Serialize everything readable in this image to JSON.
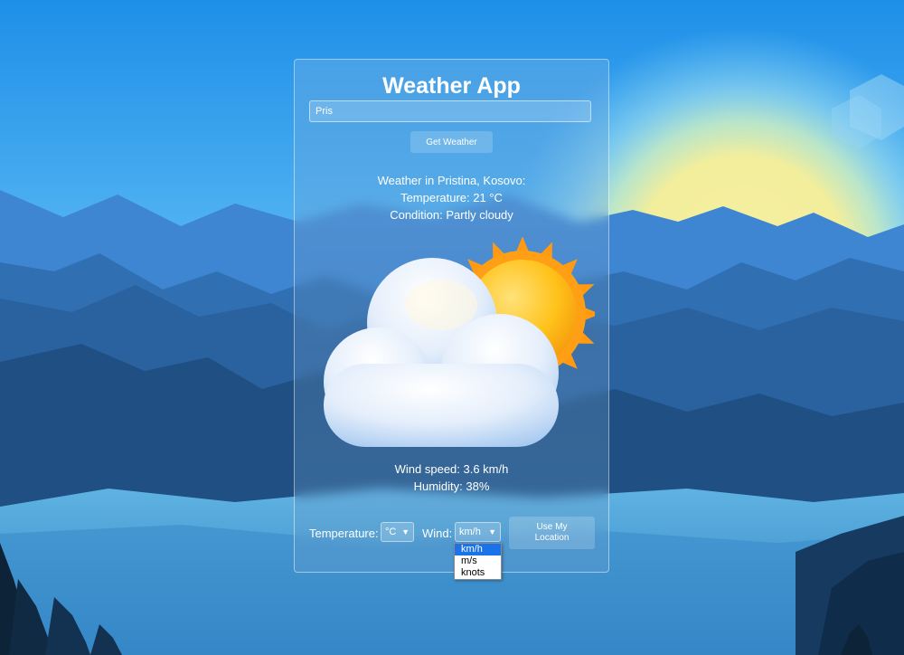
{
  "app": {
    "title": "Weather App",
    "search": {
      "value": "Pris",
      "placeholder": "Enter city"
    },
    "get_weather_label": "Get Weather"
  },
  "weather": {
    "location_line": "Weather in Pristina, Kosovo:",
    "temperature_line": "Temperature: 21 °C",
    "condition_line": "Condition: Partly cloudy",
    "wind_line": "Wind speed: 3.6 km/h",
    "humidity_line": "Humidity: 38%",
    "icon": "partly-cloudy-icon"
  },
  "controls": {
    "temperature_label": "Temperature:",
    "temperature_unit": "°C",
    "wind_label": "Wind:",
    "wind_unit": "km/h",
    "location_button_line1": "Use My",
    "location_button_line2": "Location"
  },
  "wind_dropdown": {
    "options": [
      "km/h",
      "m/s",
      "knots"
    ],
    "selected": "km/h"
  },
  "colors": {
    "sky_top": "#1e8fe8",
    "sun_glow": "#f2ee9c",
    "dropdown_highlight": "#1a73e8"
  }
}
